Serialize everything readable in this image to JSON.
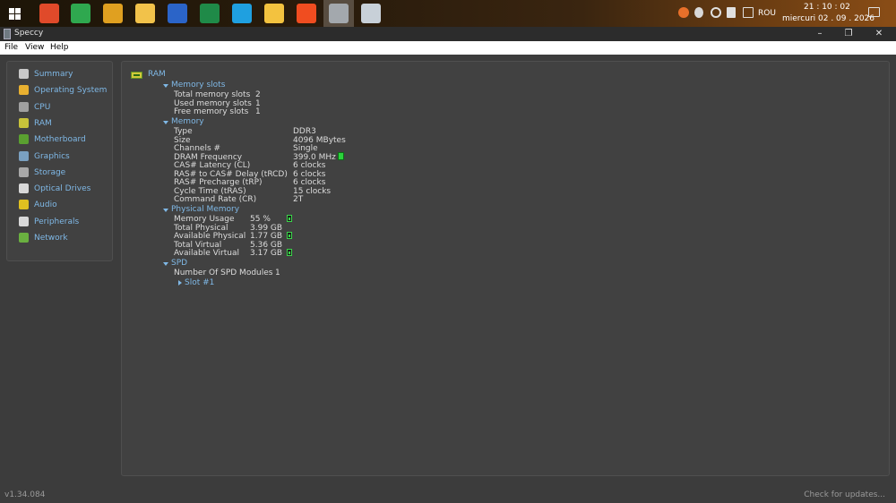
{
  "taskbar": {
    "apps": [
      {
        "name": "power-app",
        "color": "#e04a2a"
      },
      {
        "name": "green-arrow-app",
        "color": "#2fa84f"
      },
      {
        "name": "key-app",
        "color": "#e0a020"
      },
      {
        "name": "folder-mail-app",
        "color": "#f2c24a"
      },
      {
        "name": "word-app",
        "color": "#2b64c8"
      },
      {
        "name": "excel-app",
        "color": "#1f8a48"
      },
      {
        "name": "edge-app",
        "color": "#1fa0e0"
      },
      {
        "name": "file-explorer-app",
        "color": "#f3c23f"
      },
      {
        "name": "brave-app",
        "color": "#f04d20"
      },
      {
        "name": "speccy-app",
        "color": "#8a9096"
      },
      {
        "name": "network-tool-app",
        "color": "#c8d0d8"
      }
    ],
    "tray": {
      "language": "ROU",
      "time": "21 : 10 : 02",
      "date": "miercuri 02 . 09 . 2026"
    }
  },
  "window": {
    "title": "Speccy",
    "menu": [
      "File",
      "View",
      "Help"
    ]
  },
  "sidebar": {
    "items": [
      {
        "label": "Summary",
        "icon": "summary-icon",
        "color": "#c8c8c8"
      },
      {
        "label": "Operating System",
        "icon": "windows-icon",
        "color": "#e8b030"
      },
      {
        "label": "CPU",
        "icon": "cpu-icon",
        "color": "#a0a0a0"
      },
      {
        "label": "RAM",
        "icon": "ram-icon",
        "color": "#c8c23a"
      },
      {
        "label": "Motherboard",
        "icon": "motherboard-icon",
        "color": "#5aa030"
      },
      {
        "label": "Graphics",
        "icon": "graphics-icon",
        "color": "#7aa0c0"
      },
      {
        "label": "Storage",
        "icon": "storage-icon",
        "color": "#a8a8a8"
      },
      {
        "label": "Optical Drives",
        "icon": "optical-drive-icon",
        "color": "#d8d8d8"
      },
      {
        "label": "Audio",
        "icon": "audio-icon",
        "color": "#e0c020"
      },
      {
        "label": "Peripherals",
        "icon": "peripherals-icon",
        "color": "#d8d8d8"
      },
      {
        "label": "Network",
        "icon": "network-icon",
        "color": "#6ab040"
      }
    ]
  },
  "content": {
    "section_title": "RAM",
    "memory_slots": {
      "header": "Memory slots",
      "rows": [
        {
          "label": "Total memory slots",
          "value": "2"
        },
        {
          "label": "Used memory slots",
          "value": "1"
        },
        {
          "label": "Free memory slots",
          "value": "1"
        }
      ]
    },
    "memory": {
      "header": "Memory",
      "rows": [
        {
          "label": "Type",
          "value": "DDR3"
        },
        {
          "label": "Size",
          "value": "4096 MBytes"
        },
        {
          "label": "Channels #",
          "value": "Single"
        },
        {
          "label": "DRAM Frequency",
          "value": "399.0 MHz"
        },
        {
          "label": "CAS# Latency (CL)",
          "value": "6 clocks"
        },
        {
          "label": "RAS# to CAS# Delay (tRCD)",
          "value": "6 clocks"
        },
        {
          "label": "RAS# Precharge (tRP)",
          "value": "6 clocks"
        },
        {
          "label": "Cycle Time (tRAS)",
          "value": "15 clocks"
        },
        {
          "label": "Command Rate (CR)",
          "value": "2T"
        }
      ]
    },
    "physical_memory": {
      "header": "Physical Memory",
      "rows": [
        {
          "label": "Memory Usage",
          "value": "55 %"
        },
        {
          "label": "Total Physical",
          "value": "3.99 GB"
        },
        {
          "label": "Available Physical",
          "value": "1.77 GB"
        },
        {
          "label": "Total Virtual",
          "value": "5.36 GB"
        },
        {
          "label": "Available Virtual",
          "value": "3.17 GB"
        }
      ]
    },
    "spd": {
      "header": "SPD",
      "rows": [
        {
          "label": "Number Of SPD Modules",
          "value": "1"
        }
      ],
      "slot_label": "Slot #1"
    }
  },
  "statusbar": {
    "version": "v1.34.084",
    "check_updates": "Check for updates..."
  }
}
